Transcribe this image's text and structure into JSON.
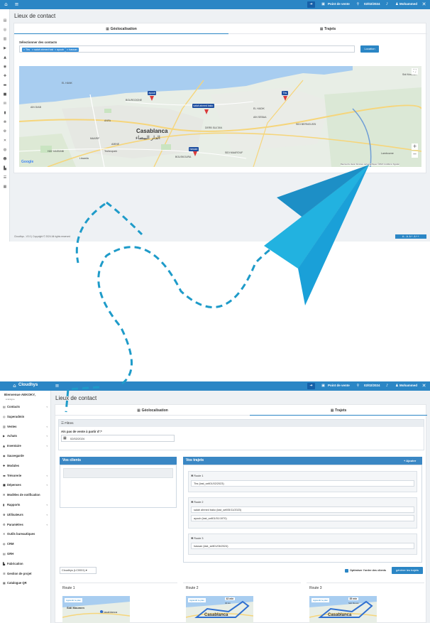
{
  "top": {
    "topbar": {
      "notif_icon": "bell-icon",
      "pos_label": "Point de vente",
      "date": "02/02/2024",
      "user": "Mohammed"
    },
    "page_title": "Lieux de contact",
    "tabs": [
      {
        "label": "Géolocalisation",
        "icon": "map-icon",
        "active": true
      },
      {
        "label": "Trajets",
        "icon": "route-icon",
        "active": false
      }
    ],
    "contacts_label": "Sélectionner des contacts",
    "chips": [
      "× Tbs",
      "× salah ahmed bako",
      "× ayoub",
      "× hassan"
    ],
    "location_button": "Location",
    "map": {
      "city": "Casablanca",
      "city_ar": "الدار البيضاء",
      "pins": [
        "ayoub",
        "salah ahmed bako",
        "Tbs",
        "hassan"
      ],
      "labels": [
        "EL HANK",
        "AIN DIAB",
        "MAARIF",
        "HAY HASSANI",
        "AMINE",
        "ANFA",
        "BOURGOGNE",
        "DERB SULTAN",
        "SIDI BERNOUSSI",
        "AIN SEBAA",
        "EL HADIK",
        "SIDI MAAROUF",
        "BOUSKOURA",
        "Lissasfa",
        "Sidi Moumen",
        "Lambourne",
        "Technopark"
      ],
      "credits": "Raccourcis clavier  Données cartographiques ©2024  Conditions  Signaler"
    },
    "footer_text": "Cloudhys - V2.0 | Copyright © 2024 All rights reserved",
    "font_sizer": "A-  A  A+  A++"
  },
  "bottom": {
    "brand": "Cloudhys",
    "welcome": "Bienvenue AEKOKY,",
    "status": "● Enligne",
    "page_title": "Lieux de contact",
    "sidebar": [
      {
        "label": "Contacts",
        "icon": "users-icon",
        "chev": true
      },
      {
        "label": "Superadmin",
        "icon": "user-shield-icon",
        "chev": false
      },
      {
        "label": "Ventes",
        "icon": "cart-icon",
        "chev": true
      },
      {
        "label": "Achats",
        "icon": "truck-icon",
        "chev": true
      },
      {
        "label": "Inventaire",
        "icon": "boxes-icon",
        "chev": true
      },
      {
        "label": "Sauvegarde",
        "icon": "database-icon",
        "chev": false
      },
      {
        "label": "Modules",
        "icon": "puzzle-icon",
        "chev": false
      },
      {
        "label": "Trésorerie",
        "icon": "money-icon",
        "chev": true
      },
      {
        "label": "Dépenses",
        "icon": "wallet-icon",
        "chev": true
      },
      {
        "label": "Modèles de notification",
        "icon": "envelope-icon",
        "chev": false
      },
      {
        "label": "Rapports",
        "icon": "chart-icon",
        "chev": true
      },
      {
        "label": "Utilisateurs",
        "icon": "users-cog-icon",
        "chev": true
      },
      {
        "label": "Paramètres",
        "icon": "gear-icon",
        "chev": true
      },
      {
        "label": "Outils bureautiques",
        "icon": "tools-icon",
        "chev": false
      },
      {
        "label": "CRM",
        "icon": "eye-icon",
        "chev": false
      },
      {
        "label": "GRH",
        "icon": "users-icon",
        "chev": false
      },
      {
        "label": "Fabrication",
        "icon": "industry-icon",
        "chev": false
      },
      {
        "label": "Gestion de projet",
        "icon": "tasks-icon",
        "chev": false
      },
      {
        "label": "Catalogue QR",
        "icon": "qr-icon",
        "chev": false
      }
    ],
    "tabs": [
      {
        "label": "Géolocalisation",
        "icon": "map-icon",
        "active": false
      },
      {
        "label": "Trajets",
        "icon": "route-icon",
        "active": true
      }
    ],
    "filter_title": "☰ Filtres",
    "date_label": "A/s pas de vente à partir d':*",
    "date_value": "02/02/2024",
    "clients_title": "Vos clients",
    "trajets_title": "Vos trajets",
    "add_button": "+ Ajouter",
    "routes": [
      {
        "title": "✖ Route 1",
        "items": [
          "Tbs (last_sell01/02/2023)"
        ]
      },
      {
        "title": "✖ Route 2",
        "items": [
          "salah ahmed bako (last_sell05/11/2023)",
          "ayoub (last_sell01/01/1970)"
        ]
      },
      {
        "title": "✖ Route 3",
        "items": [
          "hassan (last_sell01/06/2024)"
        ]
      }
    ],
    "select_value": "Cloudhys (LC0001) ▾",
    "optimize_label": "Optimiser l'ordre des clients",
    "generate_button": "générer les trajets",
    "route_cards": [
      {
        "title": "Route 1",
        "badge": "Agrandir le plan",
        "place": "Sidi Moumen",
        "place2": "Casablanca"
      },
      {
        "title": "Route 2",
        "badge": "Agrandir le plan",
        "place": "Casablanca",
        "time": "43 min",
        "dist": "30 km"
      },
      {
        "title": "Route 3",
        "badge": "Agrandir le plan",
        "place": "Casablanca",
        "time": "35 min",
        "dist": "Sidi Mouss"
      }
    ]
  }
}
